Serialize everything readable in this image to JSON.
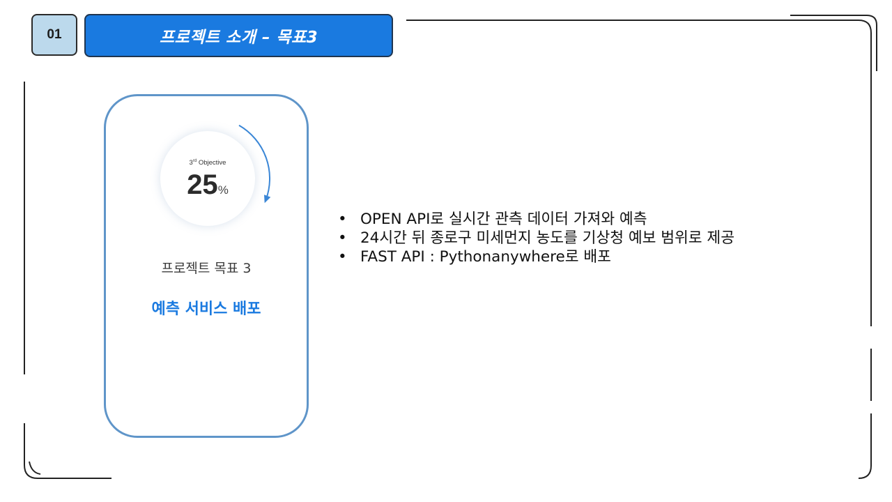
{
  "header": {
    "number": "01",
    "title": "프로젝트 소개 – 목표3"
  },
  "objective_card": {
    "ring_label_prefix": "3",
    "ring_label_ordinal": "rd",
    "ring_label_suffix": " Objective",
    "percent_value": "25",
    "percent_sign": "%",
    "progress_fraction": 0.25,
    "subtitle": "프로젝트 목표 3",
    "headline": "예측 서비스 배포"
  },
  "bullets": [
    "OPEN API로 실시간 관측 데이터 가져와 예측",
    "24시간 뒤 종로구 미세먼지 농도를 기상청 예보 범위로 제공",
    "FAST API : Pythonanywhere로 배포"
  ],
  "colors": {
    "accent": "#1a7ae0",
    "number_box": "#bcd9ec",
    "card_border": "#5f95c9",
    "frame": "#222222"
  }
}
